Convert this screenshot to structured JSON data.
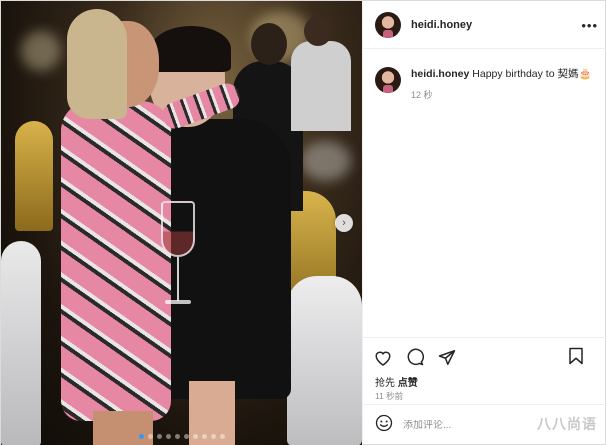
{
  "post": {
    "photo": {
      "description_icon": "next-arrow-icon",
      "carousel": {
        "count": 10,
        "active_index": 0
      }
    },
    "header": {
      "username": "heidi.honey",
      "more_icon": "more-options-icon"
    },
    "caption": {
      "username": "heidi.honey",
      "text": "Happy birthday to 契媽🎂",
      "time": "12 秒"
    },
    "actions": {
      "icons": [
        "heart-icon",
        "comment-icon",
        "share-icon",
        "bookmark-icon"
      ],
      "likes_prefix": "抢先",
      "likes_action": "点赞",
      "time": "11 秒前"
    },
    "comment": {
      "placeholder": "添加评论...",
      "emoji_icon": "emoji-icon"
    },
    "watermark": "八八尚语"
  }
}
